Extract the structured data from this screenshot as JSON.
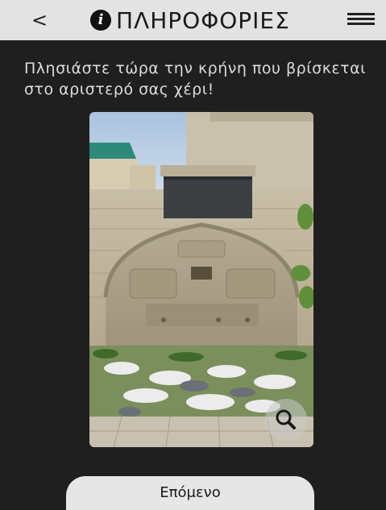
{
  "header": {
    "back_label": "<",
    "title": "ΠΛΗΡΟΦΟΡΙΕΣ"
  },
  "main": {
    "instruction": "Πλησιάστε τώρα την κρήνη που βρίσκεται στο αριστερό σας χέρι!"
  },
  "footer": {
    "next_label": "Επόμενο"
  },
  "icons": {
    "info": "info-icon",
    "menu": "hamburger-menu-icon",
    "zoom": "magnifier-icon"
  }
}
